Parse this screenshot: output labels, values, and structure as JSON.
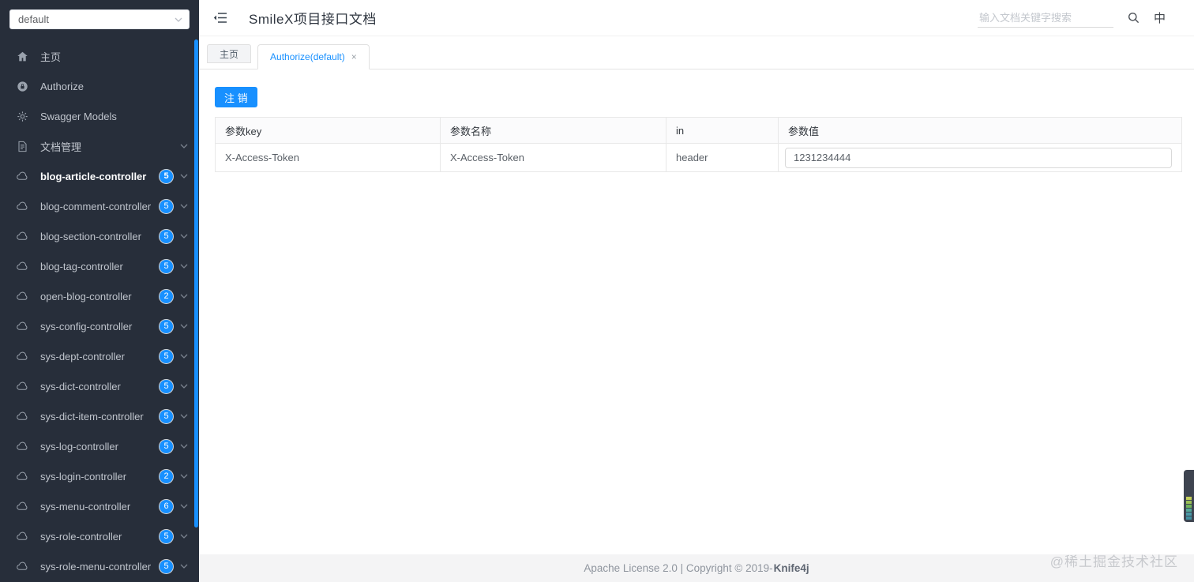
{
  "colors": {
    "primary": "#1890ff",
    "sidebar_bg": "#272e3a",
    "badge": "#1890ff",
    "active_tab_text": "#1890ff"
  },
  "sidebar": {
    "group_select": {
      "value": "default"
    },
    "menu": [
      {
        "label": "主页",
        "icon": "home-icon"
      },
      {
        "label": "Authorize",
        "icon": "lock-icon"
      },
      {
        "label": "Swagger Models",
        "icon": "gear-icon"
      },
      {
        "label": "文档管理",
        "icon": "document-icon"
      }
    ],
    "controllers": [
      {
        "label": "blog-article-controller",
        "count": "5",
        "active": true
      },
      {
        "label": "blog-comment-controller",
        "count": "5"
      },
      {
        "label": "blog-section-controller",
        "count": "5"
      },
      {
        "label": "blog-tag-controller",
        "count": "5"
      },
      {
        "label": "open-blog-controller",
        "count": "2"
      },
      {
        "label": "sys-config-controller",
        "count": "5"
      },
      {
        "label": "sys-dept-controller",
        "count": "5"
      },
      {
        "label": "sys-dict-controller",
        "count": "5"
      },
      {
        "label": "sys-dict-item-controller",
        "count": "5"
      },
      {
        "label": "sys-log-controller",
        "count": "5"
      },
      {
        "label": "sys-login-controller",
        "count": "2"
      },
      {
        "label": "sys-menu-controller",
        "count": "6"
      },
      {
        "label": "sys-role-controller",
        "count": "5"
      },
      {
        "label": "sys-role-menu-controller",
        "count": "5"
      }
    ]
  },
  "header": {
    "title": "SmileX项目接口文档",
    "search_placeholder": "输入文档关键字搜索",
    "lang_icon": "中"
  },
  "tabs": {
    "items": [
      {
        "label": "主页",
        "active": false
      },
      {
        "label": "Authorize(default)",
        "active": true,
        "close_icon": "×"
      }
    ]
  },
  "main": {
    "logout_button": "注 销",
    "table": {
      "columns": [
        "参数key",
        "参数名称",
        "in",
        "参数值"
      ],
      "rows": [
        {
          "param_key": "X-Access-Token",
          "param_name": "X-Access-Token",
          "in": "header",
          "value": "1231234444"
        }
      ]
    }
  },
  "footer": {
    "license_text": "Apache License 2.0 | Copyright © 2019-",
    "brand": "Knife4j"
  },
  "watermark": "@稀土掘金技术社区"
}
